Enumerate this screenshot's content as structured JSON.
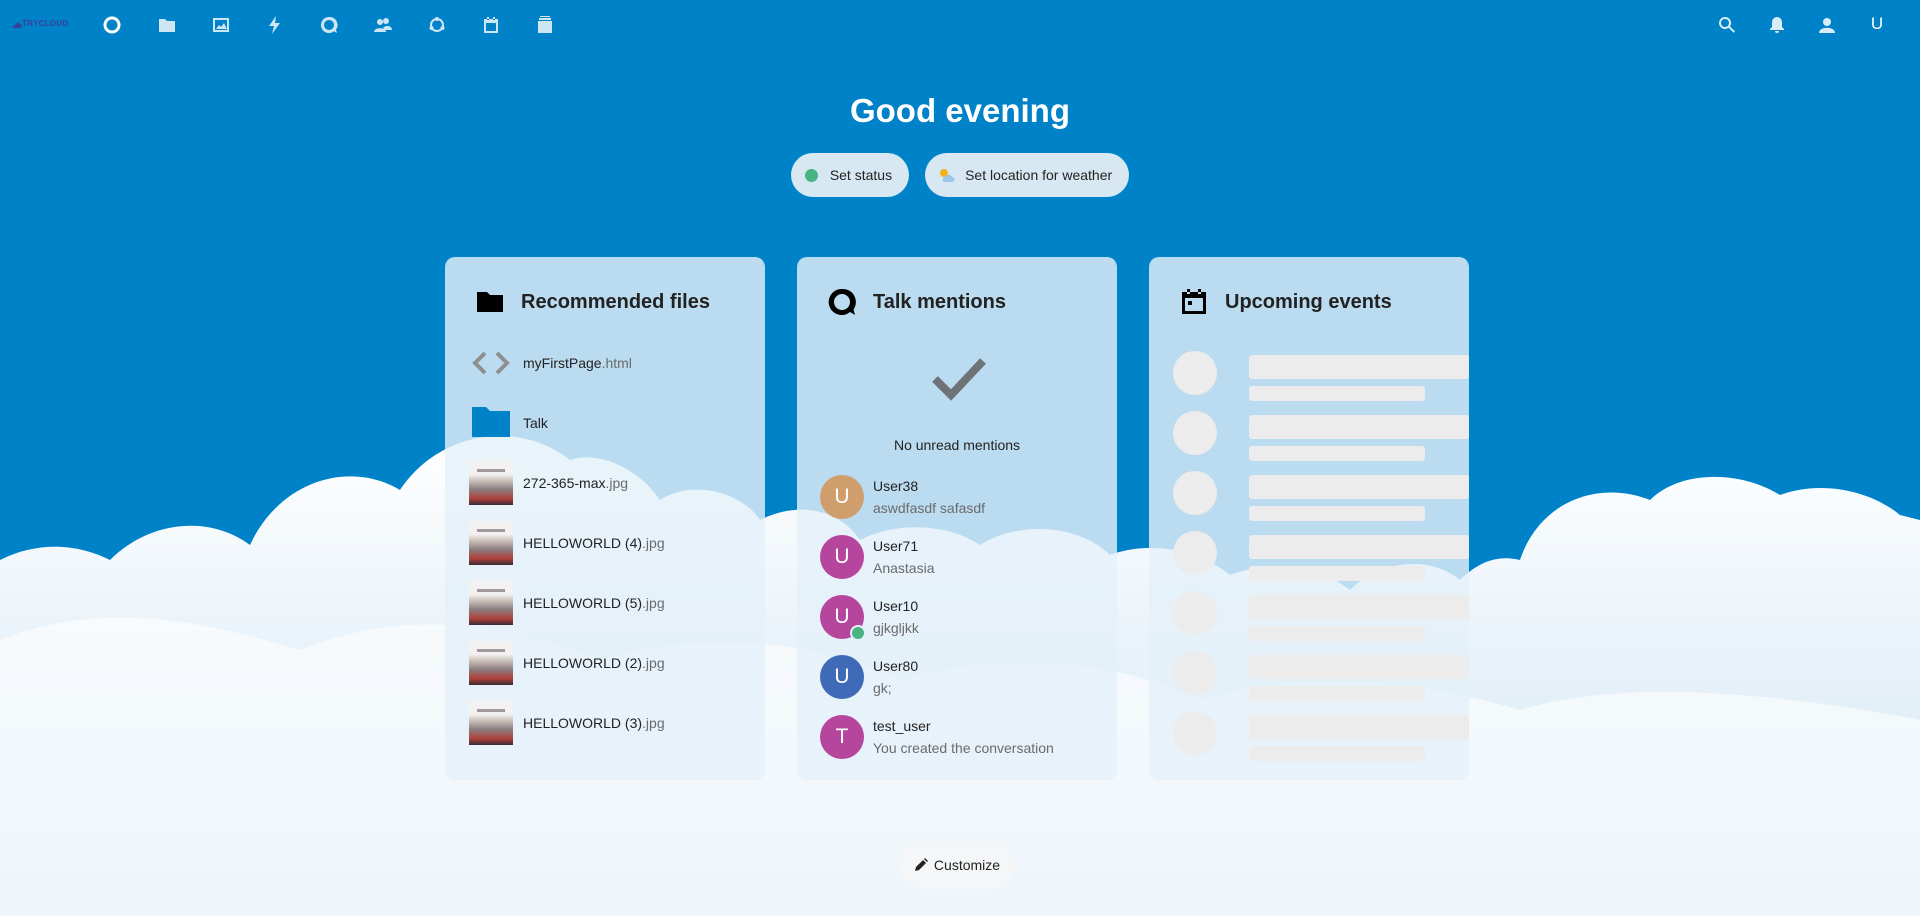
{
  "header": {
    "logo_text": "TRYCLOUD",
    "user_initial": "U",
    "apps": [
      "dashboard-icon",
      "files-icon",
      "photos-icon",
      "activity-icon",
      "talk-icon",
      "contacts-icon",
      "circles-icon",
      "calendar-icon",
      "deck-icon"
    ],
    "right_icons": [
      "search-icon",
      "notifications-icon",
      "contacts-menu-icon"
    ]
  },
  "greeting": "Good evening",
  "status": {
    "set_status_label": "Set status",
    "weather_label": "Set location for weather"
  },
  "recommended_files": {
    "title": "Recommended files",
    "items": [
      {
        "name": "myFirstPage",
        "ext": ".html",
        "type": "code"
      },
      {
        "name": "Talk",
        "ext": "",
        "type": "folder"
      },
      {
        "name": "272-365-max",
        "ext": ".jpg",
        "type": "image"
      },
      {
        "name": "HELLOWORLD (4)",
        "ext": ".jpg",
        "type": "image"
      },
      {
        "name": "HELLOWORLD (5)",
        "ext": ".jpg",
        "type": "image"
      },
      {
        "name": "HELLOWORLD (2)",
        "ext": ".jpg",
        "type": "image"
      },
      {
        "name": "HELLOWORLD (3)",
        "ext": ".jpg",
        "type": "image"
      }
    ]
  },
  "talk_mentions": {
    "title": "Talk mentions",
    "empty_text": "No unread mentions",
    "items": [
      {
        "initial": "U",
        "name": "User38",
        "message": "aswdfasdf safasdf",
        "color": "#d09e6d",
        "online": false
      },
      {
        "initial": "U",
        "name": "User71",
        "message": "Anastasia",
        "color": "#b6469d",
        "online": false
      },
      {
        "initial": "U",
        "name": "User10",
        "message": "gjkgljkk",
        "color": "#b6469d",
        "online": true
      },
      {
        "initial": "U",
        "name": "User80",
        "message": "gk;",
        "color": "#3e6ab7",
        "online": false
      },
      {
        "initial": "T",
        "name": "test_user",
        "message": "You created the conversation",
        "color": "#b6469d",
        "online": false
      }
    ]
  },
  "upcoming_events": {
    "title": "Upcoming events",
    "placeholder_rows": 7
  },
  "customize_label": "Customize",
  "colors": {
    "primary": "#0082c9",
    "online": "#49b382"
  }
}
